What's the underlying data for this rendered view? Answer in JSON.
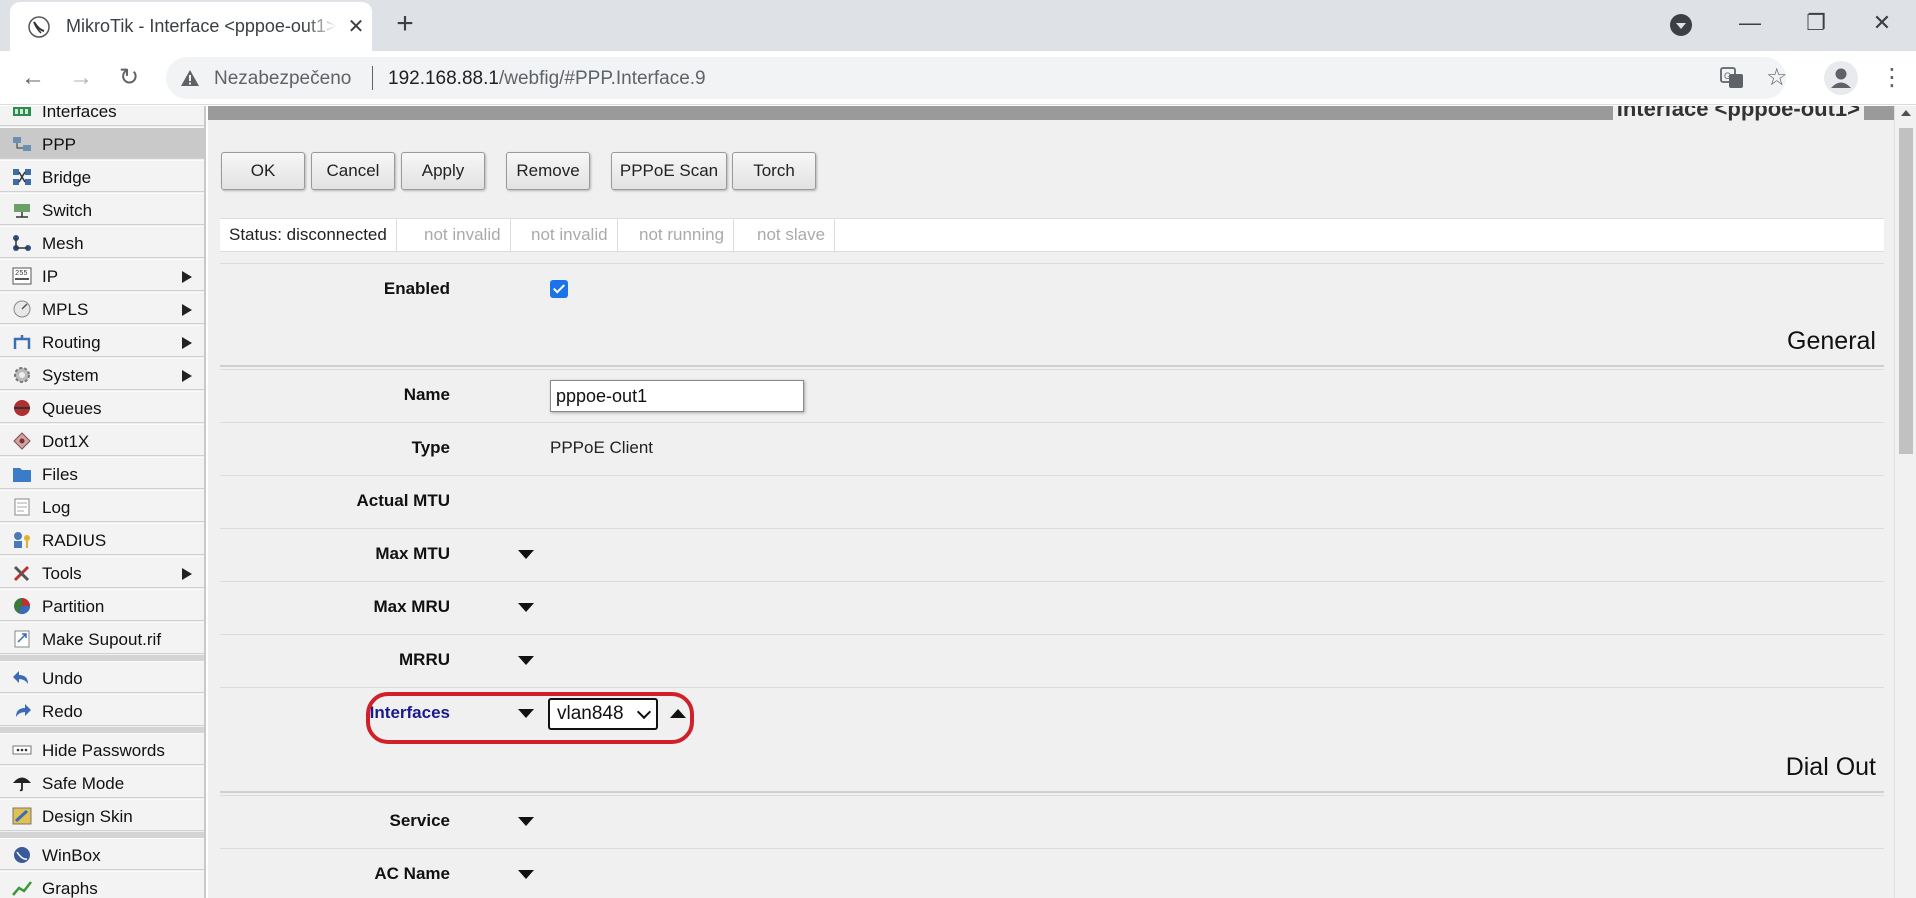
{
  "browser": {
    "tab_title": "MikroTik - Interface <pppoe-out1>",
    "tab_close": "✕",
    "new_tab": "+",
    "window_min": "—",
    "window_restore": "❐",
    "window_close": "✕",
    "insecure_label": "Nezabezpečeno",
    "url_host": "192.168.88.1",
    "url_path": "/webfig/#PPP.Interface.9",
    "back": "←",
    "forward": "→",
    "reload": "↻",
    "star": "☆",
    "menu": "⋮"
  },
  "sidebar": {
    "items": [
      {
        "label": "Interfaces",
        "icon": "interfaces-icon",
        "submenu": false,
        "active": false
      },
      {
        "label": "PPP",
        "icon": "ppp-icon",
        "submenu": false,
        "active": true
      },
      {
        "label": "Bridge",
        "icon": "bridge-icon",
        "submenu": false,
        "active": false
      },
      {
        "label": "Switch",
        "icon": "switch-icon",
        "submenu": false,
        "active": false
      },
      {
        "label": "Mesh",
        "icon": "mesh-icon",
        "submenu": false,
        "active": false
      },
      {
        "label": "IP",
        "icon": "ip-icon",
        "submenu": true,
        "active": false
      },
      {
        "label": "MPLS",
        "icon": "mpls-icon",
        "submenu": true,
        "active": false
      },
      {
        "label": "Routing",
        "icon": "routing-icon",
        "submenu": true,
        "active": false
      },
      {
        "label": "System",
        "icon": "system-icon",
        "submenu": true,
        "active": false
      },
      {
        "label": "Queues",
        "icon": "queues-icon",
        "submenu": false,
        "active": false
      },
      {
        "label": "Dot1X",
        "icon": "dot1x-icon",
        "submenu": false,
        "active": false
      },
      {
        "label": "Files",
        "icon": "files-icon",
        "submenu": false,
        "active": false
      },
      {
        "label": "Log",
        "icon": "log-icon",
        "submenu": false,
        "active": false
      },
      {
        "label": "RADIUS",
        "icon": "radius-icon",
        "submenu": false,
        "active": false
      },
      {
        "label": "Tools",
        "icon": "tools-icon",
        "submenu": true,
        "active": false
      },
      {
        "label": "Partition",
        "icon": "partition-icon",
        "submenu": false,
        "active": false
      },
      {
        "label": "Make Supout.rif",
        "icon": "supout-icon",
        "submenu": false,
        "active": false
      }
    ],
    "undo": "Undo",
    "redo": "Redo",
    "hide_passwords": "Hide Passwords",
    "safe_mode": "Safe Mode",
    "design_skin": "Design Skin",
    "winbox": "WinBox",
    "graphs": "Graphs"
  },
  "main": {
    "title": "Interface <pppoe-out1>",
    "buttons": {
      "ok": "OK",
      "cancel": "Cancel",
      "apply": "Apply",
      "remove": "Remove",
      "pppoe_scan": "PPPoE Scan",
      "torch": "Torch"
    },
    "status": [
      "Status: disconnected",
      "not invalid",
      "not invalid",
      "not running",
      "not slave"
    ],
    "fields": {
      "enabled_label": "Enabled",
      "enabled": true,
      "general_section": "General",
      "name_label": "Name",
      "name_value": "pppoe-out1",
      "type_label": "Type",
      "type_value": "PPPoE Client",
      "actual_mtu_label": "Actual MTU",
      "max_mtu_label": "Max MTU",
      "max_mru_label": "Max MRU",
      "mrru_label": "MRRU",
      "interfaces_label": "Interfaces",
      "interfaces_value": "vlan848",
      "dial_out_section": "Dial Out",
      "service_label": "Service",
      "ac_name_label": "AC Name"
    }
  },
  "colors": {
    "highlight": "#d0202a",
    "checkbox": "#1a73e8",
    "interfaces_label": "#1a1a8c"
  }
}
